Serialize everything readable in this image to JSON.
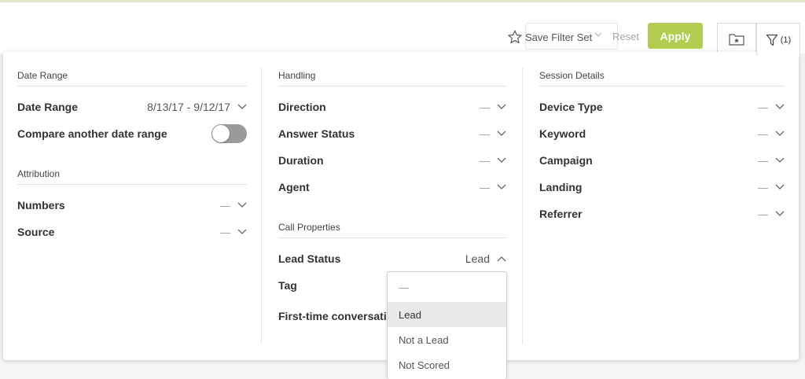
{
  "toolbar": {
    "save_filter_label": "Save Filter Set",
    "reset_label": "Reset",
    "apply_label": "Apply",
    "filter_count": "(1)"
  },
  "colors": {
    "apply_green": "#b3cc50",
    "toggle_off": "#9a9a9a"
  },
  "col1": {
    "date_range_section": "Date Range",
    "date_range_label": "Date Range",
    "date_range_value": "8/13/17 - 9/12/17",
    "compare_label": "Compare another date range",
    "compare_enabled": false,
    "attribution_section": "Attribution",
    "numbers_label": "Numbers",
    "numbers_value": "—",
    "source_label": "Source",
    "source_value": "—"
  },
  "col2": {
    "handling_section": "Handling",
    "direction_label": "Direction",
    "direction_value": "—",
    "answer_status_label": "Answer Status",
    "answer_status_value": "—",
    "duration_label": "Duration",
    "duration_value": "—",
    "agent_label": "Agent",
    "agent_value": "—",
    "call_properties_section": "Call Properties",
    "lead_status_label": "Lead Status",
    "lead_status_value": "Lead",
    "tag_label": "Tag",
    "first_time_label": "First-time conversatio"
  },
  "col3": {
    "session_section": "Session Details",
    "device_type_label": "Device Type",
    "device_type_value": "—",
    "keyword_label": "Keyword",
    "keyword_value": "—",
    "campaign_label": "Campaign",
    "campaign_value": "—",
    "landing_label": "Landing",
    "landing_value": "—",
    "referrer_label": "Referrer",
    "referrer_value": "—"
  },
  "lead_dropdown": {
    "options": [
      "—",
      "Lead",
      "Not a Lead",
      "Not Scored"
    ],
    "selected": "Lead"
  }
}
